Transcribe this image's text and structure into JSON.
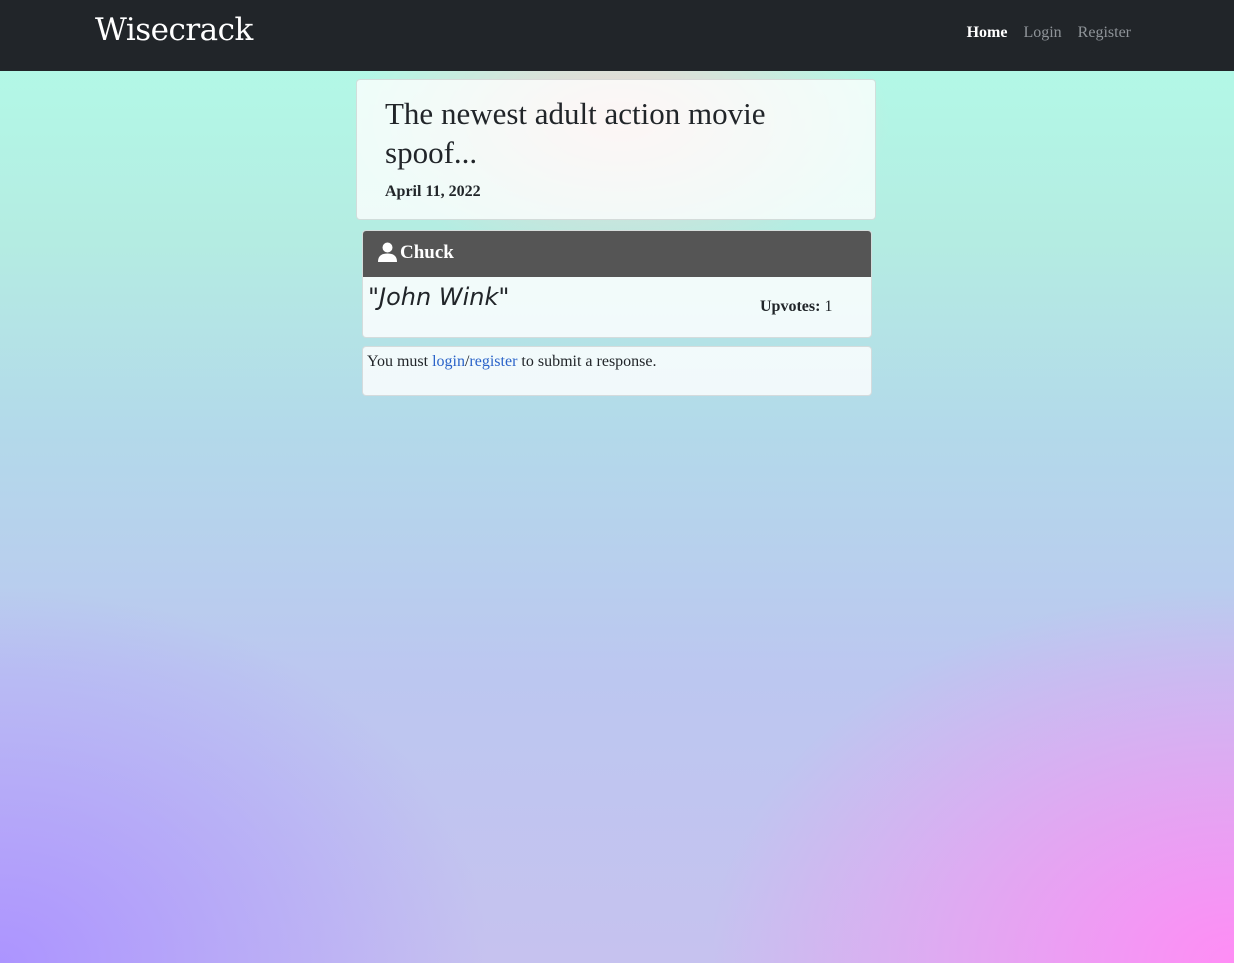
{
  "navbar": {
    "brand": "Wisecrack",
    "links": [
      {
        "label": "Home",
        "active": true
      },
      {
        "label": "Login",
        "active": false
      },
      {
        "label": "Register",
        "active": false
      }
    ]
  },
  "post": {
    "title": "The newest adult action movie spoof...",
    "date": "April 11, 2022"
  },
  "response": {
    "user_icon": "user-icon",
    "user": "Chuck",
    "text": "\"John Wink\"",
    "upvotes_label": "Upvotes:",
    "upvotes_count": "1"
  },
  "notice": {
    "prefix": "You must ",
    "login_link": "login",
    "separator": "/",
    "register_link": "register",
    "suffix": " to submit a response."
  },
  "colors": {
    "navbar_bg": "#212529",
    "response_header_bg": "#555555",
    "link": "#2a63c9"
  }
}
